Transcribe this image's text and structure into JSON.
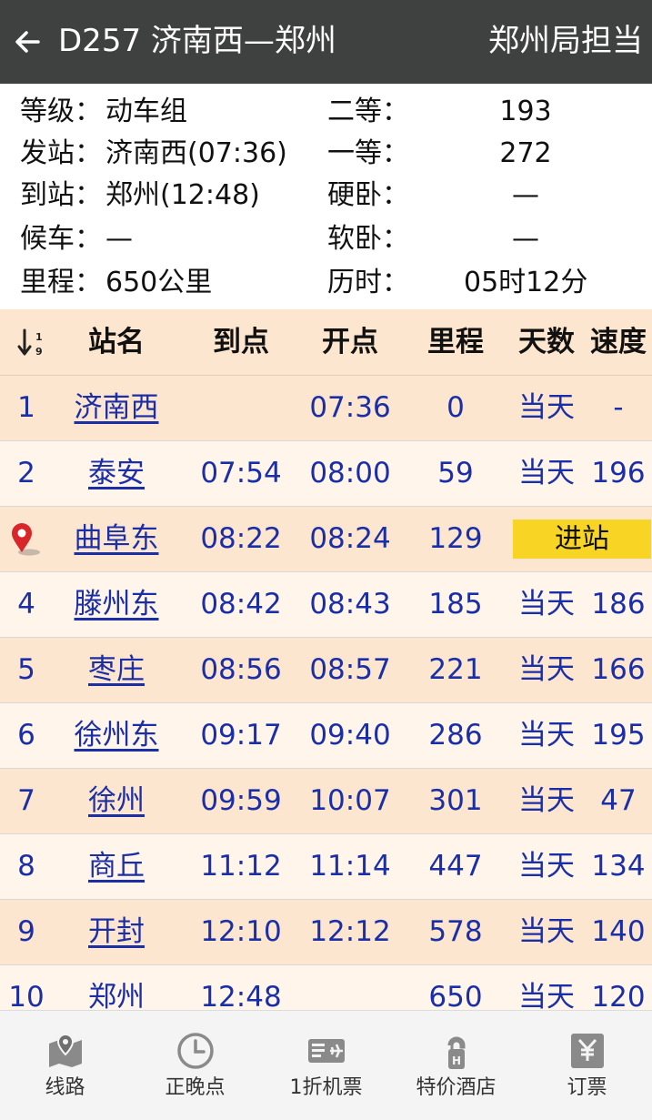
{
  "header": {
    "back_icon": "arrow-left-icon",
    "title": "D257 济南西—郑州",
    "bureau": "郑州局担当"
  },
  "info": {
    "left": [
      {
        "label": "等级：",
        "value": "动车组"
      },
      {
        "label": "发站：",
        "value": "济南西(07:36)"
      },
      {
        "label": "到站：",
        "value": "郑州(12:48)"
      },
      {
        "label": "候车：",
        "value": "—"
      },
      {
        "label": "里程：",
        "value": "650公里"
      }
    ],
    "right": [
      {
        "label": "二等：",
        "value": "193"
      },
      {
        "label": "一等：",
        "value": "272"
      },
      {
        "label": "硬卧：",
        "value": "—"
      },
      {
        "label": "软卧：",
        "value": "—"
      },
      {
        "label": "历时：",
        "value": "05时12分"
      }
    ]
  },
  "table": {
    "sort_icon": "sort-order-icon",
    "headers": {
      "station": "站名",
      "arrive": "到点",
      "depart": "开点",
      "distance": "里程",
      "days": "天数",
      "speed": "速度"
    },
    "rows": [
      {
        "no": "1",
        "station": "济南西",
        "arrive": "",
        "depart": "07:36",
        "distance": "0",
        "days": "当天",
        "speed": "-"
      },
      {
        "no": "2",
        "station": "泰安",
        "arrive": "07:54",
        "depart": "08:00",
        "distance": "59",
        "days": "当天",
        "speed": "196"
      },
      {
        "no": "",
        "station": "曲阜东",
        "arrive": "08:22",
        "depart": "08:24",
        "distance": "129",
        "status": "进站",
        "current": true
      },
      {
        "no": "4",
        "station": "滕州东",
        "arrive": "08:42",
        "depart": "08:43",
        "distance": "185",
        "days": "当天",
        "speed": "186"
      },
      {
        "no": "5",
        "station": "枣庄",
        "arrive": "08:56",
        "depart": "08:57",
        "distance": "221",
        "days": "当天",
        "speed": "166"
      },
      {
        "no": "6",
        "station": "徐州东",
        "arrive": "09:17",
        "depart": "09:40",
        "distance": "286",
        "days": "当天",
        "speed": "195"
      },
      {
        "no": "7",
        "station": "徐州",
        "arrive": "09:59",
        "depart": "10:07",
        "distance": "301",
        "days": "当天",
        "speed": "47"
      },
      {
        "no": "8",
        "station": "商丘",
        "arrive": "11:12",
        "depart": "11:14",
        "distance": "447",
        "days": "当天",
        "speed": "134"
      },
      {
        "no": "9",
        "station": "开封",
        "arrive": "12:10",
        "depart": "12:12",
        "distance": "578",
        "days": "当天",
        "speed": "140"
      },
      {
        "no": "10",
        "station": "郑州",
        "arrive": "12:48",
        "depart": "",
        "distance": "650",
        "days": "当天",
        "speed": "120"
      }
    ]
  },
  "tabbar": {
    "tabs": [
      {
        "label": "线路",
        "icon": "map-route-icon"
      },
      {
        "label": "正晚点",
        "icon": "clock-icon"
      },
      {
        "label": "1折机票",
        "icon": "flight-ticket-icon"
      },
      {
        "label": "特价酒店",
        "icon": "hotel-tag-icon"
      },
      {
        "label": "订票",
        "icon": "yen-ticket-icon"
      }
    ]
  },
  "colors": {
    "header_bg": "#3f4140",
    "row_odd": "#fde6cf",
    "row_even": "#fff5ea",
    "link_text": "#1a2ea8",
    "status_badge": "#f8d524",
    "pin": "#d9262a"
  }
}
